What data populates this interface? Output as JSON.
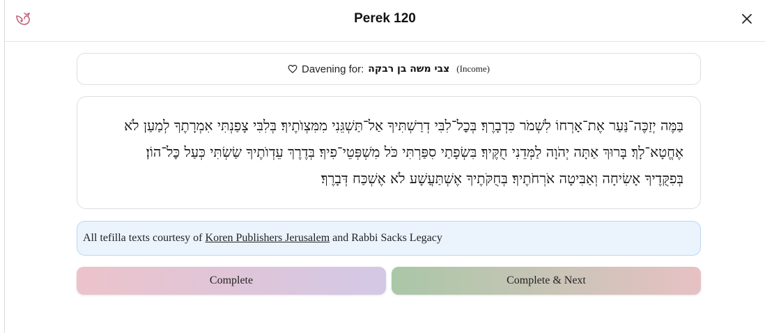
{
  "header": {
    "title": "Perek 120",
    "close_icon": "close-icon",
    "logo_icon": "bird-logo-icon",
    "accent_color": "#c2607a"
  },
  "davening": {
    "label": "Davening for:",
    "name": "צבי משה בן רבקה",
    "category": "(Income)",
    "icon": "heart-icon"
  },
  "passage": {
    "text": "בַּמֶּה יְזַכֶּה־נַּעַר אֶת־אָרְחוֹ לִשְׁמֹר כִּדְבָרֶךָ׃ בְּכׇל־לִבִּי דְרַשְׁתִּיךָ אַל־תַּשְׁגֵּנִי מִמִּצְוֺתֶיךָ׃ בְּלִבִּי צָפַנְתִּי אִמְרָתֶךָ לְמַעַן לֹא אֶחֱטָא־לָךְ׃ בָּרוּךְ אַתָּה יְהֹוָה לַמְּדֵנִי חֻקֶּיךָ׃ בִּשְׂפָתַי סִפַּרְתִּי כֹּל מִשְׁפְּטֵי־פִיךָ׃ בְּדֶרֶךְ עֵדְוֺתֶיךָ שַׂשְׂתִּי כְּעַל כׇּל־הוֹן׃ בְּפִקֻּדֶיךָ אָשִׂיחָה וְאַבִּיטָה אֹרְחֹתֶיךָ׃ בְּחֻקֹּתֶיךָ אֶשְׁתַּעֲשָׁע לֹא אֶשְׁכַּח דְּבָרֶךָ׃"
  },
  "credit": {
    "prefix": "All tefilla texts courtesy of",
    "link": "Koren Publishers Jerusalem",
    "suffix": "and Rabbi Sacks Legacy"
  },
  "actions": {
    "complete_label": "Complete",
    "complete_next_label": "Complete & Next"
  }
}
